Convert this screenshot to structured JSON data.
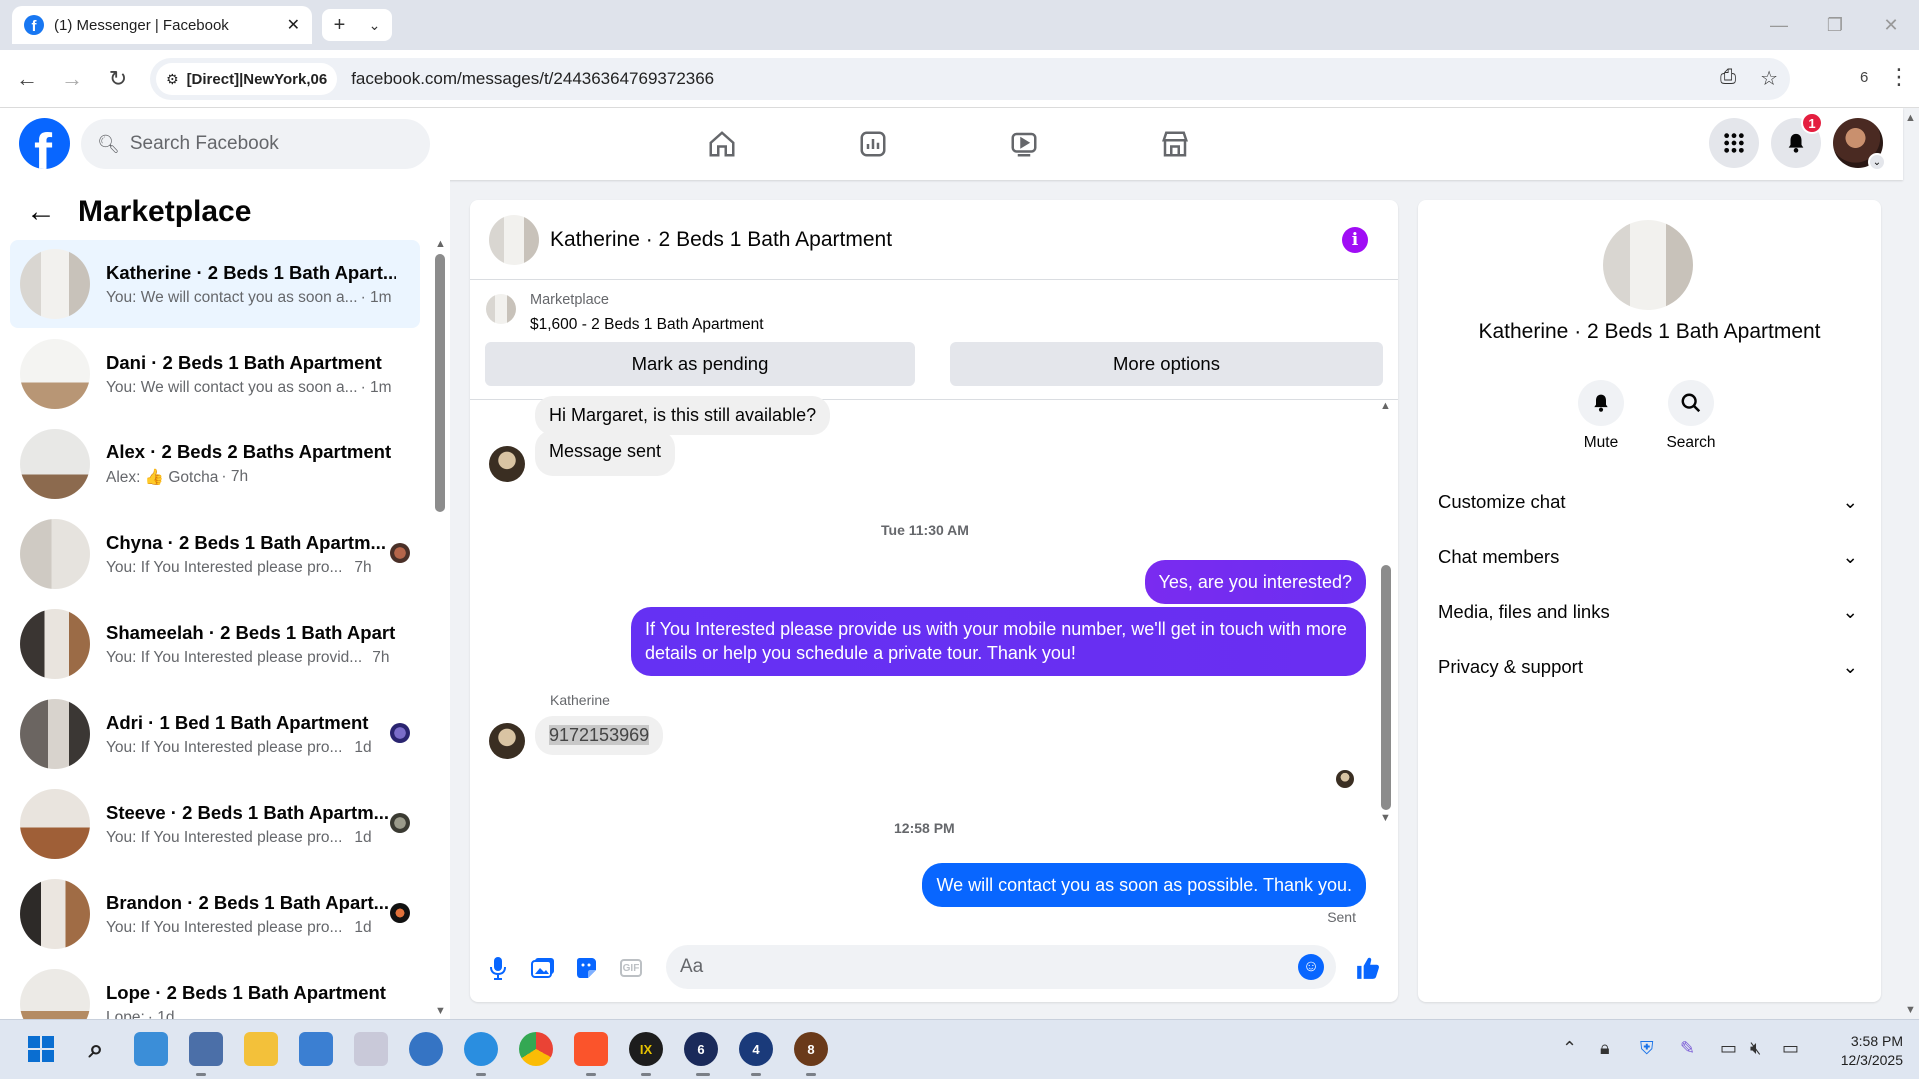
{
  "browser": {
    "tab_title": "(1) Messenger | Facebook",
    "site_chip": "[Direct]|NewYork,06",
    "url": "facebook.com/messages/t/24436364769372366",
    "extensions_count": "6"
  },
  "fb": {
    "search_placeholder": "Search Facebook",
    "notifications_badge": "1"
  },
  "sidebar": {
    "title": "Marketplace",
    "conversations": [
      {
        "name": "Katherine · 2 Beds 1 Bath Apart...",
        "snippet": "You: We will contact you as soon a...",
        "time": "· 1m",
        "active": true
      },
      {
        "name": "Dani · 2 Beds 1 Bath Apartment",
        "snippet": "You: We will contact you as soon a...",
        "time": "· 1m"
      },
      {
        "name": "Alex · 2 Beds 2 Baths Apartment",
        "snippet": "Alex: 👍 Gotcha",
        "time": "· 7h"
      },
      {
        "name": "Chyna · 2 Beds 1 Bath Apartm...",
        "snippet": "You: If You Interested please pro...",
        "time": "7h"
      },
      {
        "name": "Shameelah · 2 Beds 1 Bath Apart...",
        "snippet": "You: If You Interested please provid...",
        "time": "7h"
      },
      {
        "name": "Adri · 1 Bed 1 Bath Apartment",
        "snippet": "You: If You Interested please pro...",
        "time": "1d"
      },
      {
        "name": "Steeve · 2 Beds 1 Bath Apartm...",
        "snippet": "You: If You Interested please pro...",
        "time": "1d"
      },
      {
        "name": "Brandon · 2 Beds 1 Bath Apart...",
        "snippet": "You: If You Interested please pro...",
        "time": "1d"
      },
      {
        "name": "Lope · 2 Beds 1 Bath Apartment",
        "snippet": "Lope: ",
        "time": "· 1d"
      }
    ]
  },
  "chat": {
    "title": "Katherine · 2 Beds 1 Bath Apartment",
    "marketplace_label": "Marketplace",
    "listing": "$1,600 - 2 Beds 1 Bath Apartment",
    "mark_pending": "Mark as pending",
    "more_options": "More options",
    "messages": {
      "m1": "Hi Margaret, is this still available?",
      "m2": "Message sent",
      "ts1": "Tue 11:30 AM",
      "m3": "Yes, are you interested?",
      "m4": "If You Interested please provide us with your mobile number, we'll get in touch with more details or help you schedule a private tour. Thank you!",
      "sender": "Katherine",
      "m5": "9172153969",
      "ts2": "12:58 PM",
      "m6": "We will contact you as soon as possible. Thank you.",
      "status": "Sent"
    },
    "composer_placeholder": "Aa",
    "gif_label": "GIF",
    "out_color": "#0866ff",
    "out_color_purple": "#7a2bf0"
  },
  "info": {
    "title": "Katherine · 2 Beds 1 Bath Apartment",
    "mute": "Mute",
    "search": "Search",
    "sections": [
      "Customize chat",
      "Chat members",
      "Media, files and links",
      "Privacy & support"
    ]
  },
  "taskbar": {
    "badges": [
      "6",
      "4",
      "8"
    ],
    "time": "3:58 PM",
    "date": "12/3/2025"
  }
}
